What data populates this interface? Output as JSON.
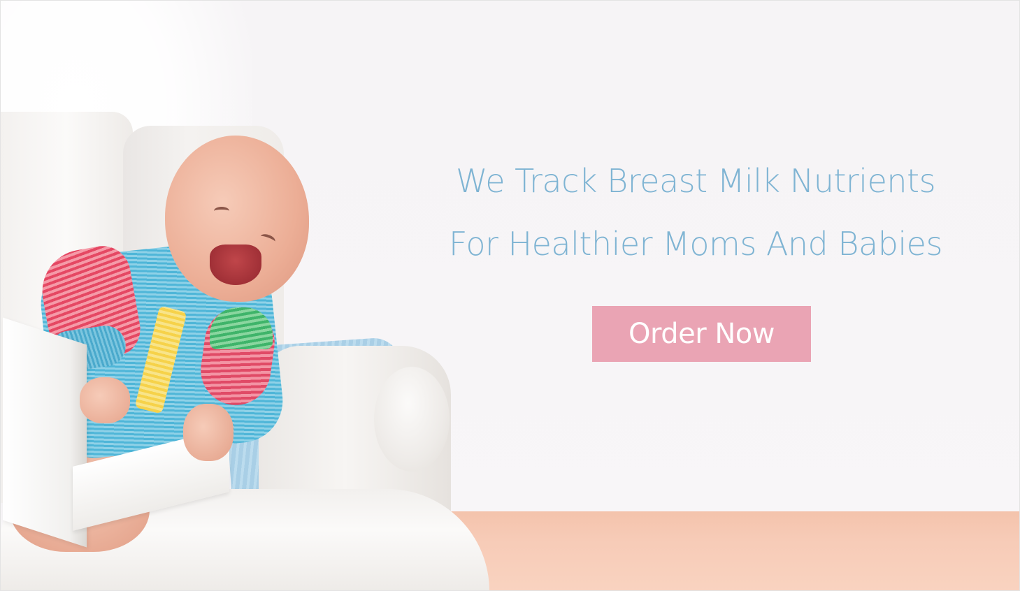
{
  "hero": {
    "headline_line1": "We Track Breast Milk Nutrients",
    "headline_line2": "For Healthier Moms And Babies",
    "cta_label": "Order Now"
  },
  "colors": {
    "headline": "#7fb4d3",
    "cta_background": "#eaa4b4",
    "cta_text": "#ffffff",
    "background": "#f6f4f6",
    "floor": "#f7cbb7"
  }
}
